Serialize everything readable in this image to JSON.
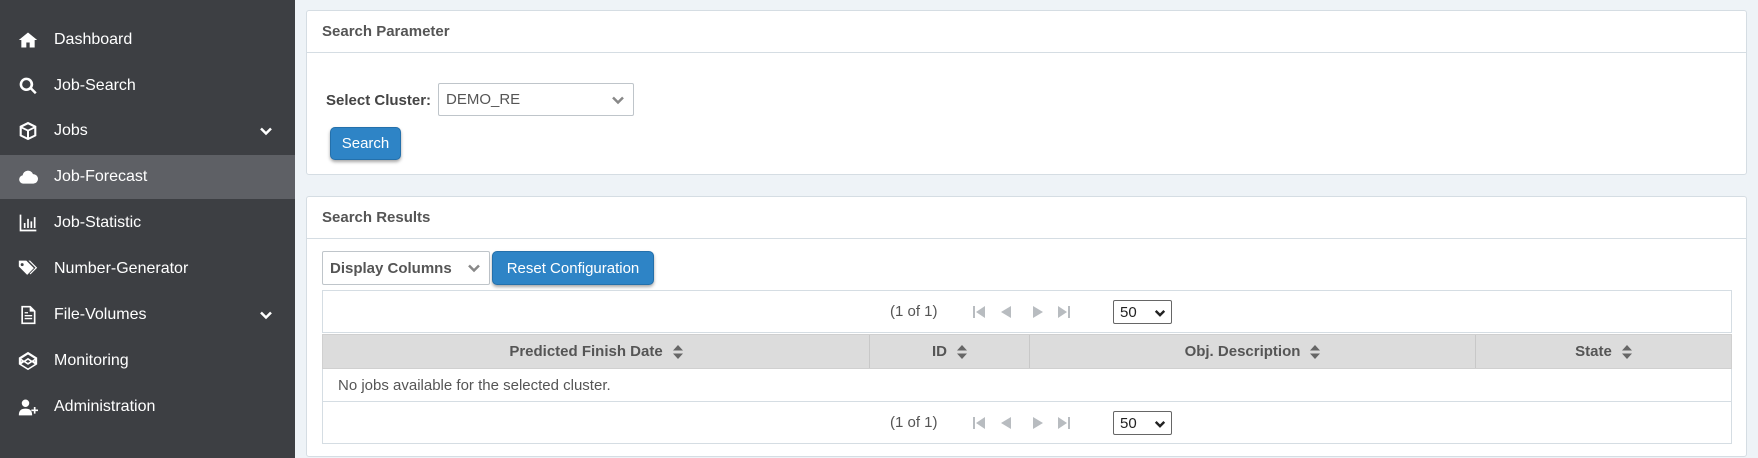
{
  "sidebar": {
    "items": [
      {
        "label": "Dashboard",
        "icon": "home-icon"
      },
      {
        "label": "Job-Search",
        "icon": "search-icon"
      },
      {
        "label": "Jobs",
        "icon": "cube-icon",
        "expandable": true
      },
      {
        "label": "Job-Forecast",
        "icon": "cloud-icon",
        "active": true
      },
      {
        "label": "Job-Statistic",
        "icon": "bar-chart-icon"
      },
      {
        "label": "Number-Generator",
        "icon": "tags-icon"
      },
      {
        "label": "File-Volumes",
        "icon": "file-icon",
        "expandable": true
      },
      {
        "label": "Monitoring",
        "icon": "codepen-icon"
      },
      {
        "label": "Administration",
        "icon": "user-plus-icon"
      }
    ]
  },
  "search_panel": {
    "title": "Search Parameter",
    "cluster_label": "Select Cluster:",
    "cluster_value": "DEMO_RE",
    "search_button": "Search"
  },
  "results_panel": {
    "title": "Search Results",
    "display_columns": "Display Columns",
    "reset_button": "Reset Configuration",
    "paginator_report": "(1 of 1)",
    "rows_per_page": "50",
    "columns": [
      "Predicted Finish Date",
      "ID",
      "Obj. Description",
      "State"
    ],
    "empty_message": "No jobs available for the selected cluster."
  },
  "colors": {
    "sidebar_bg": "#3d3f43",
    "sidebar_active": "#5e6065",
    "accent_button": "#2e84c6",
    "table_header_bg": "#dcdcdc"
  }
}
